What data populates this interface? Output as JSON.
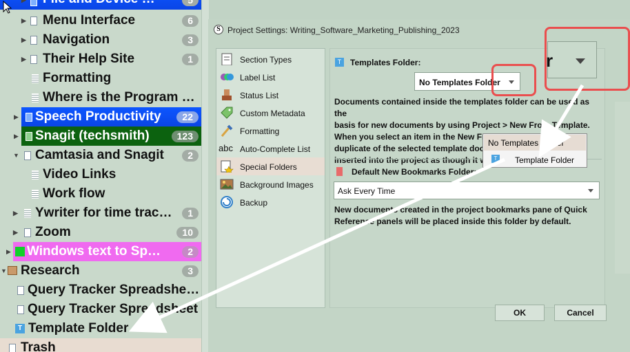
{
  "binder": {
    "items": [
      {
        "label": "File and Device …",
        "badge": "5"
      },
      {
        "label": "Menu Interface",
        "badge": "6"
      },
      {
        "label": "Navigation",
        "badge": "3"
      },
      {
        "label": "Their Help Site",
        "badge": "1"
      },
      {
        "label": "Formatting"
      },
      {
        "label": "Where is the Program …"
      },
      {
        "label": "Speech Productivity",
        "badge": "22"
      },
      {
        "label": "Snagit (techsmith)",
        "badge": "123"
      },
      {
        "label": "Camtasia and Snagit",
        "badge": "2"
      },
      {
        "label": "Video Links"
      },
      {
        "label": "Work flow"
      },
      {
        "label": "Ywriter for time trac…",
        "badge": "1"
      },
      {
        "label": "Zoom",
        "badge": "10"
      },
      {
        "label": "Windows text to Sp…",
        "badge": "2"
      },
      {
        "label": "Research",
        "badge": "3"
      },
      {
        "label": "Query Tracker Spreadshe…"
      },
      {
        "label": "Query Tracker Spreadsheet"
      },
      {
        "label": "Template Folder"
      },
      {
        "label": "Trash"
      }
    ]
  },
  "dialog": {
    "title": "Project Settings: Writing_Software_Marketing_Publishing_2023",
    "categories": [
      {
        "label": "Section Types",
        "icon": "section-types-icon"
      },
      {
        "label": "Label List",
        "icon": "label-list-icon"
      },
      {
        "label": "Status List",
        "icon": "status-list-icon"
      },
      {
        "label": "Custom Metadata",
        "icon": "custom-metadata-icon"
      },
      {
        "label": "Formatting",
        "icon": "formatting-icon"
      },
      {
        "label": "Auto-Complete List",
        "icon": "auto-complete-icon"
      },
      {
        "label": "Special Folders",
        "icon": "special-folders-icon"
      },
      {
        "label": "Background Images",
        "icon": "background-images-icon"
      },
      {
        "label": "Backup",
        "icon": "backup-icon"
      }
    ],
    "templates": {
      "label": "Templates Folder:",
      "value": "No Templates Folder",
      "desc": [
        "Documents contained inside the templates folder can be used as the",
        "basis for new documents by using Project > New From Template.",
        "When you select an item in the New From Template menu a",
        "duplicate of the selected template doc",
        "inserted into the project as though it w"
      ],
      "dropdown": [
        "No Templates Folder",
        "Template Folder"
      ]
    },
    "bookmarks": {
      "label": "Default New Bookmarks Folder:",
      "value": "Ask Every Time",
      "desc": [
        "New documents created in the project bookmarks pane of Quick",
        "Reference panels will be placed inside this folder by default."
      ]
    },
    "ok": "OK",
    "cancel": "Cancel"
  },
  "zoom_callout": {
    "letter": "r"
  },
  "colors": {
    "annotation": "#ea4e4e",
    "selection_blue": "#0d56ff",
    "selection_green": "#0c620f",
    "selection_pink": "#f06af0"
  }
}
